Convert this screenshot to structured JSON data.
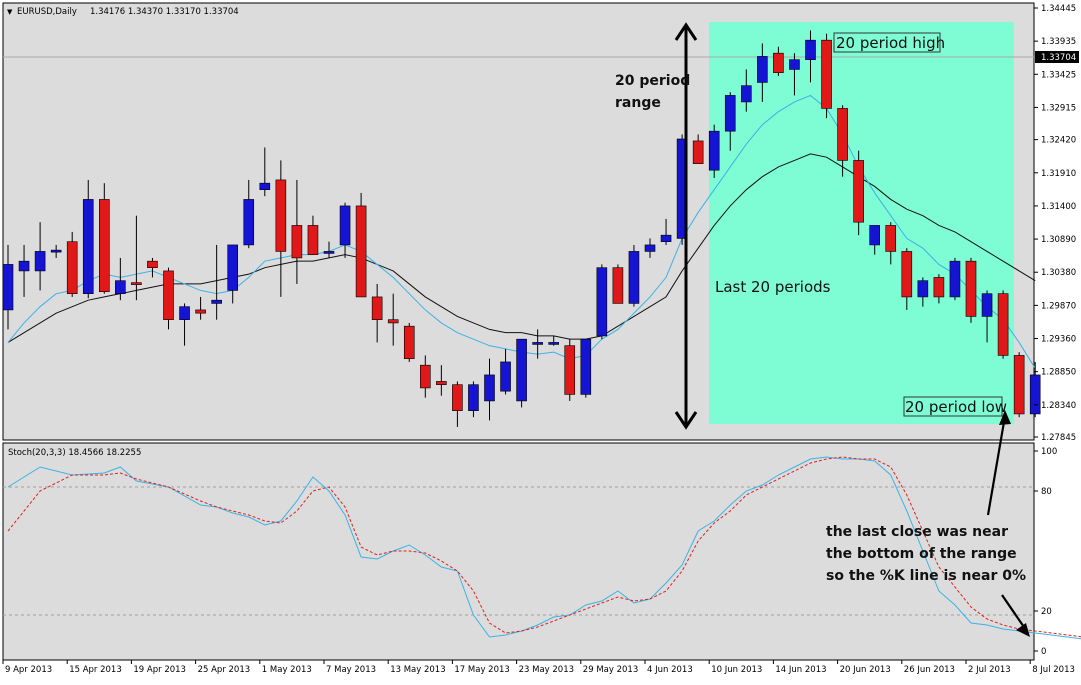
{
  "header": {
    "symbol": "EURUSD,Daily",
    "ohlc": "1.34176 1.34370 1.33170 1.33704"
  },
  "stoch_header": {
    "label": "Stoch(20,3,3) 18.4566 18.2255"
  },
  "current_price_label": "1.33704",
  "annotations": {
    "period_high": "20 period high",
    "period_low": "20 period low",
    "range_line1": "20 period",
    "range_line2": "range",
    "last_periods": "Last 20 periods",
    "note_line1": "the last close was near",
    "note_line2": "the bottom of the range",
    "note_line3": "so the %K line is near 0%"
  },
  "colors": {
    "bull": "#1414d2",
    "bear": "#e01818",
    "highlight": "#7efcd4",
    "ma_fast": "#3bb3e6",
    "ma_slow": "#111111",
    "stoch_k": "#3bb3e6",
    "stoch_d": "#dd2222",
    "background": "#dcdcdc"
  },
  "chart_data": [
    {
      "type": "candlestick",
      "title": "EURUSD,Daily",
      "ylim": [
        1.27845,
        1.34445
      ],
      "y_ticks": [
        "1.34445",
        "1.33935",
        "1.33425",
        "1.32915",
        "1.32420",
        "1.31910",
        "1.31400",
        "1.30890",
        "1.30380",
        "1.29870",
        "1.29360",
        "1.28850",
        "1.28340",
        "1.27845"
      ],
      "x_ticks": [
        "9 Apr 2013",
        "15 Apr 2013",
        "19 Apr 2013",
        "25 Apr 2013",
        "1 May 2013",
        "7 May 2013",
        "13 May 2013",
        "17 May 2013",
        "23 May 2013",
        "29 May 2013",
        "4 Jun 2013",
        "10 Jun 2013",
        "14 Jun 2013",
        "20 Jun 2013",
        "26 Jun 2013",
        "2 Jul 2013",
        "8 Jul 2013"
      ],
      "candles": [
        {
          "o": 1.298,
          "h": 1.308,
          "l": 1.295,
          "c": 1.305
        },
        {
          "o": 1.304,
          "h": 1.308,
          "l": 1.3,
          "c": 1.3055
        },
        {
          "o": 1.304,
          "h": 1.3115,
          "l": 1.301,
          "c": 1.307
        },
        {
          "o": 1.307,
          "h": 1.308,
          "l": 1.306,
          "c": 1.3072
        },
        {
          "o": 1.3085,
          "h": 1.31,
          "l": 1.3,
          "c": 1.3005
        },
        {
          "o": 1.3005,
          "h": 1.318,
          "l": 1.2998,
          "c": 1.315
        },
        {
          "o": 1.315,
          "h": 1.3175,
          "l": 1.3005,
          "c": 1.3008
        },
        {
          "o": 1.3005,
          "h": 1.306,
          "l": 1.2995,
          "c": 1.3025
        },
        {
          "o": 1.3022,
          "h": 1.3125,
          "l": 1.2995,
          "c": 1.302
        },
        {
          "o": 1.3055,
          "h": 1.306,
          "l": 1.303,
          "c": 1.3045
        },
        {
          "o": 1.304,
          "h": 1.3045,
          "l": 1.295,
          "c": 1.2965
        },
        {
          "o": 1.2965,
          "h": 1.299,
          "l": 1.2925,
          "c": 1.2985
        },
        {
          "o": 1.298,
          "h": 1.3,
          "l": 1.2965,
          "c": 1.2975
        },
        {
          "o": 1.299,
          "h": 1.308,
          "l": 1.2965,
          "c": 1.2995
        },
        {
          "o": 1.301,
          "h": 1.308,
          "l": 1.299,
          "c": 1.308
        },
        {
          "o": 1.308,
          "h": 1.318,
          "l": 1.3075,
          "c": 1.315
        },
        {
          "o": 1.3165,
          "h": 1.323,
          "l": 1.3155,
          "c": 1.3175
        },
        {
          "o": 1.318,
          "h": 1.321,
          "l": 1.3,
          "c": 1.307
        },
        {
          "o": 1.311,
          "h": 1.318,
          "l": 1.302,
          "c": 1.306
        },
        {
          "o": 1.311,
          "h": 1.3125,
          "l": 1.3065,
          "c": 1.3065
        },
        {
          "o": 1.307,
          "h": 1.3085,
          "l": 1.306,
          "c": 1.307
        },
        {
          "o": 1.308,
          "h": 1.3145,
          "l": 1.306,
          "c": 1.314
        },
        {
          "o": 1.314,
          "h": 1.316,
          "l": 1.3,
          "c": 1.3
        },
        {
          "o": 1.3,
          "h": 1.302,
          "l": 1.293,
          "c": 1.2965
        },
        {
          "o": 1.2965,
          "h": 1.3005,
          "l": 1.2925,
          "c": 1.296
        },
        {
          "o": 1.2955,
          "h": 1.296,
          "l": 1.29,
          "c": 1.2905
        },
        {
          "o": 1.2895,
          "h": 1.291,
          "l": 1.2845,
          "c": 1.286
        },
        {
          "o": 1.287,
          "h": 1.2895,
          "l": 1.2848,
          "c": 1.2865
        },
        {
          "o": 1.2865,
          "h": 1.287,
          "l": 1.28,
          "c": 1.2825
        },
        {
          "o": 1.2825,
          "h": 1.287,
          "l": 1.2815,
          "c": 1.2865
        },
        {
          "o": 1.284,
          "h": 1.2905,
          "l": 1.281,
          "c": 1.288
        },
        {
          "o": 1.2855,
          "h": 1.292,
          "l": 1.285,
          "c": 1.29
        },
        {
          "o": 1.284,
          "h": 1.293,
          "l": 1.283,
          "c": 1.2935
        },
        {
          "o": 1.293,
          "h": 1.295,
          "l": 1.2905,
          "c": 1.293
        },
        {
          "o": 1.293,
          "h": 1.294,
          "l": 1.2925,
          "c": 1.293
        },
        {
          "o": 1.2925,
          "h": 1.2935,
          "l": 1.284,
          "c": 1.285
        },
        {
          "o": 1.285,
          "h": 1.2935,
          "l": 1.2845,
          "c": 1.2935
        },
        {
          "o": 1.294,
          "h": 1.305,
          "l": 1.2935,
          "c": 1.3045
        },
        {
          "o": 1.3045,
          "h": 1.305,
          "l": 1.299,
          "c": 1.299
        },
        {
          "o": 1.299,
          "h": 1.308,
          "l": 1.2985,
          "c": 1.307
        },
        {
          "o": 1.307,
          "h": 1.309,
          "l": 1.306,
          "c": 1.308
        },
        {
          "o": 1.3085,
          "h": 1.312,
          "l": 1.308,
          "c": 1.3095
        },
        {
          "o": 1.309,
          "h": 1.325,
          "l": 1.308,
          "c": 1.3243
        },
        {
          "o": 1.324,
          "h": 1.325,
          "l": 1.321,
          "c": 1.3205
        },
        {
          "o": 1.3195,
          "h": 1.3265,
          "l": 1.3183,
          "c": 1.3255
        },
        {
          "o": 1.3255,
          "h": 1.3315,
          "l": 1.3225,
          "c": 1.331
        },
        {
          "o": 1.33,
          "h": 1.335,
          "l": 1.3285,
          "c": 1.3325
        },
        {
          "o": 1.333,
          "h": 1.339,
          "l": 1.33,
          "c": 1.337
        },
        {
          "o": 1.3375,
          "h": 1.3385,
          "l": 1.334,
          "c": 1.3345
        },
        {
          "o": 1.335,
          "h": 1.3375,
          "l": 1.331,
          "c": 1.3365
        },
        {
          "o": 1.3365,
          "h": 1.341,
          "l": 1.333,
          "c": 1.3395
        },
        {
          "o": 1.3395,
          "h": 1.3405,
          "l": 1.3275,
          "c": 1.329
        },
        {
          "o": 1.329,
          "h": 1.3295,
          "l": 1.3185,
          "c": 1.321
        },
        {
          "o": 1.321,
          "h": 1.3225,
          "l": 1.3095,
          "c": 1.3115
        },
        {
          "o": 1.308,
          "h": 1.311,
          "l": 1.3065,
          "c": 1.311
        },
        {
          "o": 1.311,
          "h": 1.3115,
          "l": 1.305,
          "c": 1.307
        },
        {
          "o": 1.307,
          "h": 1.3075,
          "l": 1.298,
          "c": 1.3
        },
        {
          "o": 1.3,
          "h": 1.303,
          "l": 1.2985,
          "c": 1.3025
        },
        {
          "o": 1.303,
          "h": 1.3035,
          "l": 1.299,
          "c": 1.3
        },
        {
          "o": 1.3,
          "h": 1.306,
          "l": 1.2995,
          "c": 1.3055
        },
        {
          "o": 1.3055,
          "h": 1.306,
          "l": 1.296,
          "c": 1.297
        },
        {
          "o": 1.297,
          "h": 1.301,
          "l": 1.293,
          "c": 1.3005
        },
        {
          "o": 1.3005,
          "h": 1.301,
          "l": 1.2905,
          "c": 1.291
        },
        {
          "o": 1.291,
          "h": 1.2915,
          "l": 1.2815,
          "c": 1.282
        },
        {
          "o": 1.282,
          "h": 1.29,
          "l": 1.2815,
          "c": 1.288
        }
      ],
      "ma_fast": [
        1.293,
        1.296,
        1.2985,
        1.3005,
        1.301,
        1.3025,
        1.3035,
        1.303,
        1.3035,
        1.304,
        1.303,
        1.302,
        1.301,
        1.3005,
        1.301,
        1.303,
        1.3055,
        1.306,
        1.3065,
        1.3065,
        1.307,
        1.308,
        1.307,
        1.305,
        1.303,
        1.3005,
        1.298,
        1.296,
        1.2945,
        1.2935,
        1.2925,
        1.292,
        1.2915,
        1.2912,
        1.2915,
        1.2905,
        1.291,
        1.2935,
        1.295,
        1.2975,
        1.3,
        1.303,
        1.309,
        1.313,
        1.3165,
        1.32,
        1.3235,
        1.3265,
        1.3285,
        1.33,
        1.331,
        1.329,
        1.325,
        1.32,
        1.316,
        1.3125,
        1.309,
        1.3075,
        1.305,
        1.3035,
        1.301,
        1.2985,
        1.2965,
        1.293,
        1.289
      ],
      "ma_slow": [
        1.293,
        1.2945,
        1.296,
        1.2975,
        1.2985,
        1.2995,
        1.3,
        1.3005,
        1.301,
        1.3015,
        1.302,
        1.302,
        1.302,
        1.3025,
        1.303,
        1.3035,
        1.3045,
        1.305,
        1.3055,
        1.3055,
        1.306,
        1.3065,
        1.306,
        1.305,
        1.304,
        1.302,
        1.3,
        1.2985,
        1.297,
        1.296,
        1.295,
        1.2945,
        1.2945,
        1.294,
        1.294,
        1.2935,
        1.2935,
        1.294,
        1.2955,
        1.297,
        1.2985,
        1.3,
        1.304,
        1.3075,
        1.311,
        1.314,
        1.3165,
        1.3185,
        1.32,
        1.321,
        1.322,
        1.3215,
        1.32,
        1.3185,
        1.317,
        1.315,
        1.3135,
        1.3125,
        1.311,
        1.31,
        1.3085,
        1.307,
        1.3055,
        1.304,
        1.3025
      ]
    },
    {
      "type": "line",
      "title": "Stoch(20,3,3) 18.4566 18.2255",
      "ylim": [
        0,
        100
      ],
      "y_ticks": [
        "100",
        "80",
        "20",
        "0"
      ],
      "series": [
        {
          "name": "%K",
          "values": [
            82,
            92,
            88,
            89,
            92,
            85,
            82,
            73,
            72,
            69,
            67,
            63,
            65,
            75,
            87,
            80,
            68,
            47,
            46,
            50,
            53,
            48,
            42,
            40,
            18,
            7,
            8,
            10,
            13,
            17,
            18,
            23,
            25,
            30,
            24,
            26,
            34,
            43,
            60,
            65,
            73,
            80,
            83,
            88,
            92,
            96,
            97,
            96,
            96,
            95,
            88,
            70,
            50,
            30,
            23,
            14,
            13,
            11,
            10,
            9,
            8,
            7,
            6,
            5,
            4
          ],
          "x": [
            0,
            2,
            4,
            6,
            7,
            8,
            10,
            12,
            13,
            14,
            15,
            16,
            17,
            18,
            19,
            20,
            21,
            22,
            23,
            24,
            25,
            26,
            27,
            28,
            29,
            30,
            31,
            32,
            33,
            34,
            35,
            36,
            37,
            38,
            39,
            40,
            41,
            42,
            43,
            44,
            45,
            46,
            47,
            48,
            49,
            50,
            51,
            52,
            53,
            54,
            55,
            56,
            57,
            58,
            59,
            60,
            61,
            62,
            63,
            64,
            65,
            66,
            67,
            68,
            69
          ]
        },
        {
          "name": "%D",
          "values": [
            60,
            80,
            88,
            88,
            89,
            86,
            82,
            75,
            72,
            70,
            68,
            65,
            64,
            70,
            80,
            82,
            72,
            52,
            48,
            50,
            50,
            49,
            45,
            40,
            30,
            14,
            9,
            10,
            12,
            15,
            18,
            21,
            24,
            27,
            25,
            26,
            30,
            40,
            55,
            64,
            70,
            78,
            82,
            86,
            90,
            94,
            96,
            97,
            96,
            96,
            92,
            78,
            60,
            42,
            32,
            22,
            16,
            13,
            11,
            10,
            9,
            8,
            7,
            6,
            6
          ],
          "x": [
            0,
            2,
            4,
            6,
            7,
            8,
            10,
            12,
            13,
            14,
            15,
            16,
            17,
            18,
            19,
            20,
            21,
            22,
            23,
            24,
            25,
            26,
            27,
            28,
            29,
            30,
            31,
            32,
            33,
            34,
            35,
            36,
            37,
            38,
            39,
            40,
            41,
            42,
            43,
            44,
            45,
            46,
            47,
            48,
            49,
            50,
            51,
            52,
            53,
            54,
            55,
            56,
            57,
            58,
            59,
            60,
            61,
            62,
            63,
            64,
            65,
            66,
            67,
            68,
            69
          ]
        }
      ]
    }
  ]
}
